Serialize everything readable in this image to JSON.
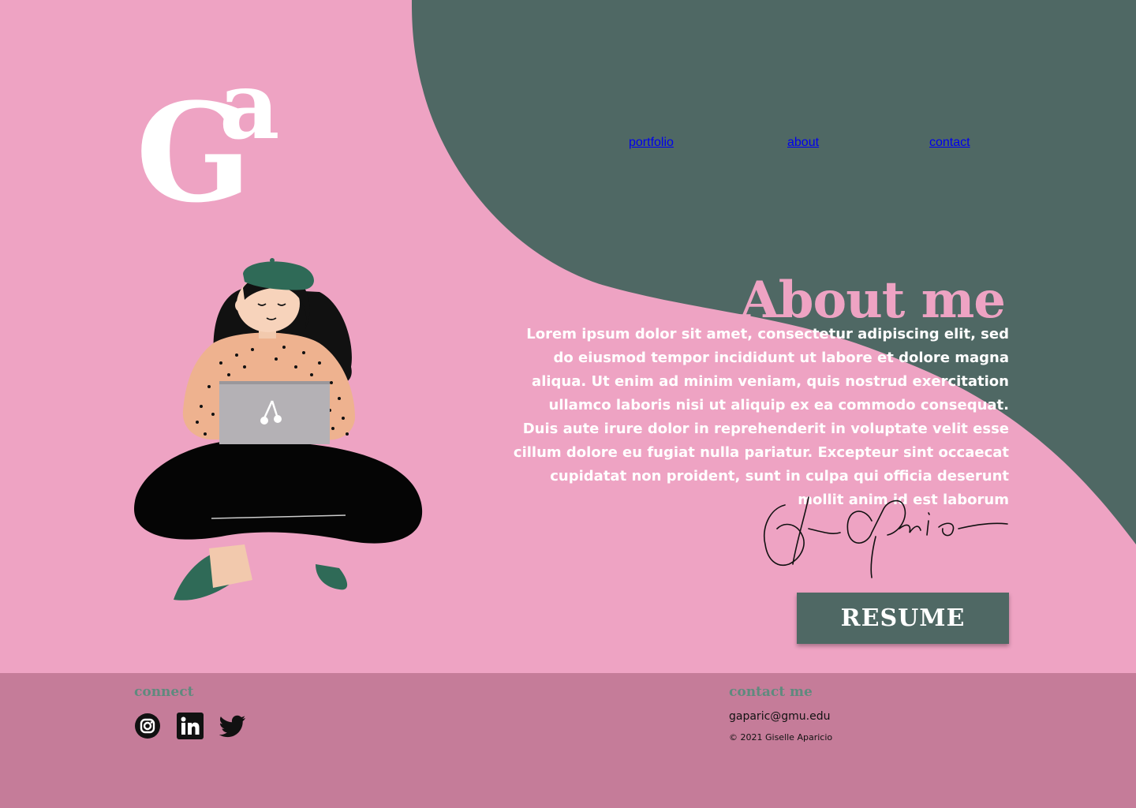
{
  "colors": {
    "pink": "#eea3c3",
    "green": "#4f6864",
    "footer": "#c57c99",
    "white": "#ffffff"
  },
  "logo": {
    "letter_big": "G",
    "letter_small": "a"
  },
  "nav": {
    "items": [
      {
        "label": "portfolio"
      },
      {
        "label": "about"
      },
      {
        "label": "contact"
      }
    ]
  },
  "about": {
    "title": "About me",
    "body": "Lorem ipsum dolor sit amet, consectetur adipiscing elit, sed do eiusmod tempor incididunt ut labore et dolore magna aliqua. Ut enim ad minim veniam, quis nostrud exercitation ullamco laboris nisi ut aliquip ex ea commodo consequat. Duis aute irure dolor in reprehenderit in voluptate velit esse cillum dolore eu fugiat nulla pariatur. Excepteur sint occaecat cupidatat non proident, sunt in culpa qui officia deserunt mollit anim id est laborum",
    "signature_text": "G. Aparicio",
    "resume_label": "RESUME"
  },
  "footer": {
    "connect_heading": "connect",
    "socials": [
      {
        "icon": "instagram-icon"
      },
      {
        "icon": "linkedin-icon"
      },
      {
        "icon": "twitter-icon"
      }
    ],
    "contact_heading": "contact me",
    "email": "gaparic@gmu.edu",
    "copyright": "© 2021 Giselle Aparicio"
  }
}
